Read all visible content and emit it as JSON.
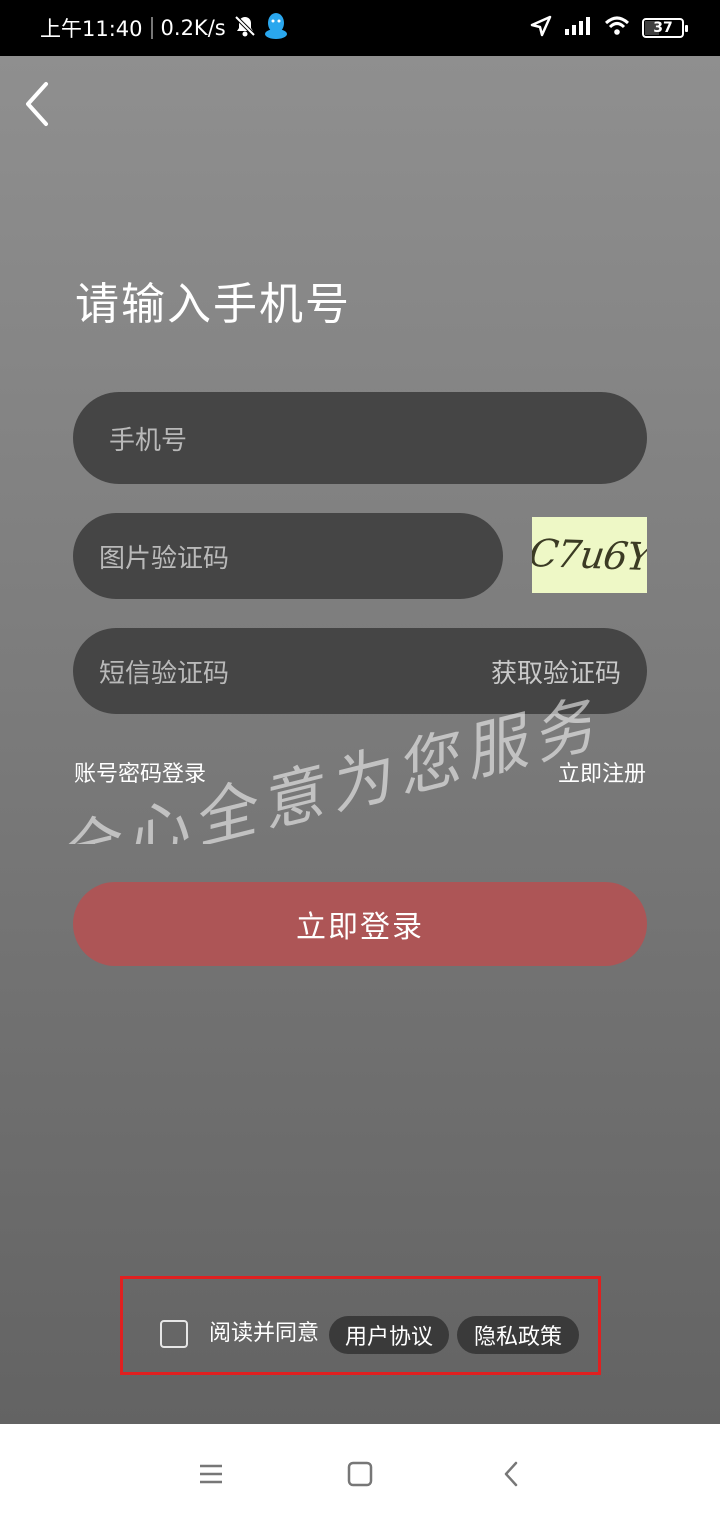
{
  "status_bar": {
    "time": "上午11:40",
    "net_speed": "0.2K/s",
    "battery": "37"
  },
  "page": {
    "title": "请输入手机号"
  },
  "form": {
    "phone_placeholder": "手机号",
    "captcha_placeholder": "图片验证码",
    "captcha_image_text": "C7u6Y",
    "sms_placeholder": "短信验证码",
    "get_code_label": "获取验证码"
  },
  "links": {
    "password_login": "账号密码登录",
    "register": "立即注册"
  },
  "login_button": "立即登录",
  "agreement": {
    "text": "阅读并同意",
    "user_agreement": "用户协议",
    "privacy_policy": "隐私政策",
    "checked": false
  },
  "watermark_text": "全心全意为您服务",
  "colors": {
    "login_button": "#ad5556",
    "field_bg": "#454545",
    "highlight_border": "#e02020",
    "captcha_bg": "#eef8c6"
  }
}
